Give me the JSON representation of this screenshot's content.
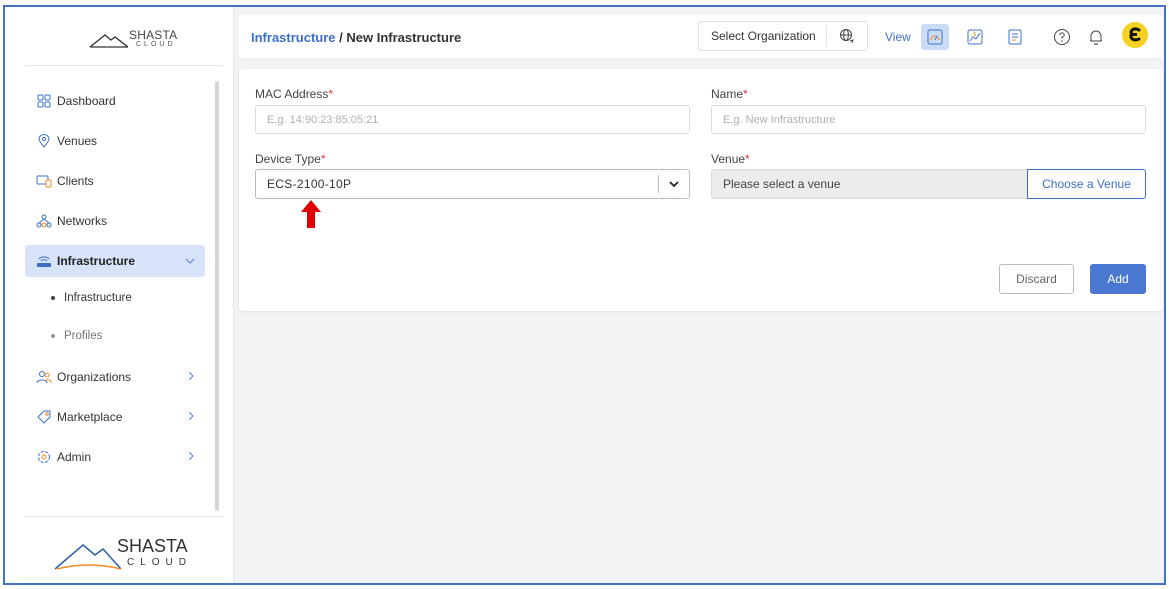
{
  "brand": {
    "logo_name": "SHASTA",
    "logo_sub": "CLOUD"
  },
  "sidebar": {
    "items": [
      {
        "label": "Dashboard",
        "icon": "dashboard-icon"
      },
      {
        "label": "Venues",
        "icon": "location-pin-icon"
      },
      {
        "label": "Clients",
        "icon": "devices-icon"
      },
      {
        "label": "Networks",
        "icon": "network-icon"
      },
      {
        "label": "Infrastructure",
        "icon": "router-icon",
        "active": true,
        "expanded": true
      },
      {
        "label": "Organizations",
        "icon": "people-icon"
      },
      {
        "label": "Marketplace",
        "icon": "tag-icon"
      },
      {
        "label": "Admin",
        "icon": "gear-icon"
      }
    ],
    "sub_items": [
      {
        "label": "Infrastructure",
        "active": true
      },
      {
        "label": "Profiles",
        "active": false
      }
    ]
  },
  "header": {
    "breadcrumb_link": "Infrastructure",
    "breadcrumb_separator": " / ",
    "breadcrumb_current": "New Infrastructure",
    "org_select_label": "Select Organization",
    "view_label": "View"
  },
  "form": {
    "mac": {
      "label": "MAC Address",
      "required": "*",
      "placeholder": "E.g. 14:90:23:85:05:21",
      "value": ""
    },
    "name": {
      "label": "Name",
      "required": "*",
      "placeholder": "E.g. New Infrastructure",
      "value": ""
    },
    "device_type": {
      "label": "Device Type",
      "required": "*",
      "value": "ECS-2100-10P"
    },
    "venue": {
      "label": "Venue",
      "required": "*",
      "value": "Please select a venue",
      "choose_label": "Choose a Venue"
    },
    "discard_label": "Discard",
    "add_label": "Add"
  },
  "colors": {
    "accent": "#3e6fc7",
    "primary_button": "#4a78d0",
    "active_nav_bg": "#d6e3f8",
    "required": "#e0343a",
    "annotation_arrow": "#e00000",
    "avatar_bg": "#f4d21f",
    "frame_border": "#4472c4"
  }
}
